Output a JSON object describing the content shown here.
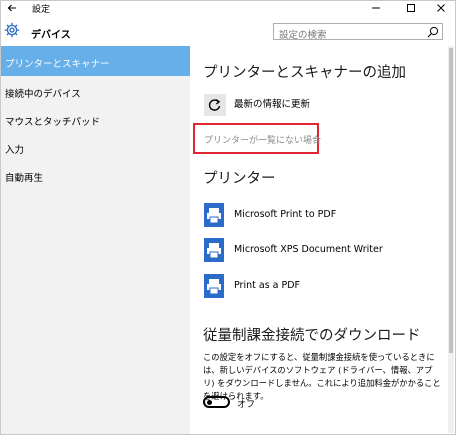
{
  "window": {
    "title": "設定",
    "app_name": "デバイス"
  },
  "search": {
    "placeholder": "設定の検索"
  },
  "sidebar": {
    "items": [
      {
        "label": "プリンターとスキャナー",
        "active": true
      },
      {
        "label": "接続中のデバイス"
      },
      {
        "label": "マウスとタッチパッド"
      },
      {
        "label": "入力"
      },
      {
        "label": "自動再生"
      }
    ]
  },
  "content": {
    "add_section_title": "プリンターとスキャナーの追加",
    "refresh_label": "最新の情報に更新",
    "missing_link": "プリンターが一覧にない場合",
    "printers_title": "プリンター",
    "printers": [
      {
        "name": "Microsoft Print to PDF"
      },
      {
        "name": "Microsoft XPS Document Writer"
      },
      {
        "name": "Print as a PDF"
      }
    ],
    "metered_title": "従量制課金接続でのダウンロード",
    "metered_desc": "この設定をオフにすると、従量制課金接続を使っているときには、新しいデバイスのソフトウェア (ドライバー、情報、アプリ) をダウンロードしません。これにより追加料金がかかることを避けられます。",
    "toggle_label": "オフ"
  },
  "colors": {
    "accent": "#66afe9",
    "highlight": "#e02431",
    "printer_icon": "#2b6cc8"
  }
}
